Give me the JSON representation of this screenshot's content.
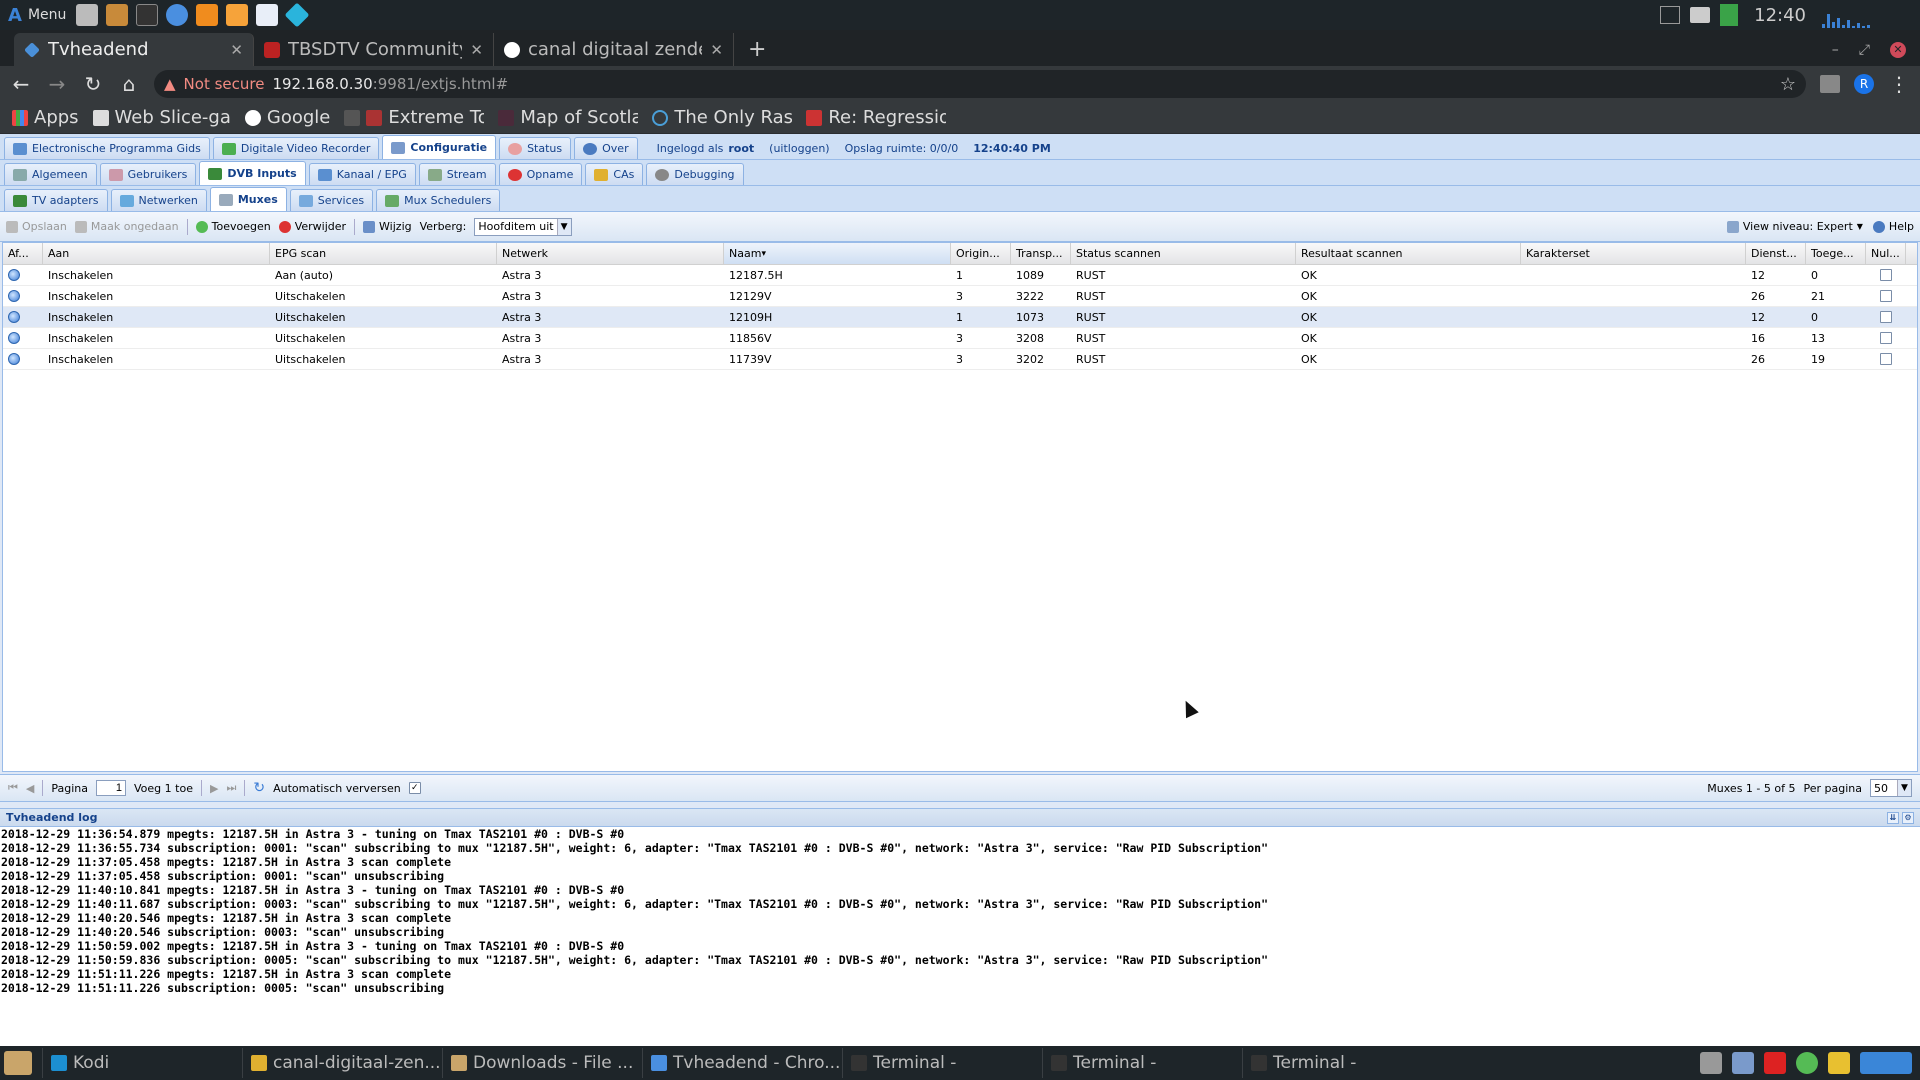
{
  "panel": {
    "menu_label": "Menu",
    "clock": "12:40"
  },
  "browser": {
    "tabs": [
      {
        "title": "Tvheadend",
        "active": true
      },
      {
        "title": "TBSDTV Community",
        "active": false
      },
      {
        "title": "canal digitaal zende",
        "active": false
      }
    ],
    "not_secure": "Not secure",
    "url_host": "192.168.0.30",
    "url_rest": ":9981/extjs.html#",
    "profile_initial": "R",
    "bookmarks": [
      "Apps",
      "Web Slice-ga",
      "Google",
      "Extreme Torr",
      "Map of Scotla",
      "The Only Ras",
      "Re: Regressio"
    ]
  },
  "tvh": {
    "main_tabs": [
      "Electronische Programma Gids",
      "Digitale Video Recorder",
      "Configuratie",
      "Status",
      "Over"
    ],
    "login_prefix": "Ingelogd als",
    "login_user": "root",
    "logout": "(uitloggen)",
    "storage": "Opslag ruimte: 0/0/0",
    "time": "12:40:40 PM",
    "config_tabs": [
      "Algemeen",
      "Gebruikers",
      "DVB Inputs",
      "Kanaal / EPG",
      "Stream",
      "Opname",
      "CAs",
      "Debugging"
    ],
    "dvb_tabs": [
      "TV adapters",
      "Netwerken",
      "Muxes",
      "Services",
      "Mux Schedulers"
    ],
    "toolbar": {
      "save": "Opslaan",
      "undo": "Maak ongedaan",
      "add": "Toevoegen",
      "delete": "Verwijder",
      "edit": "Wijzig",
      "hide_label": "Verberg:",
      "hide_value": "Hoofditem uit",
      "view_level": "View niveau: Expert",
      "help": "Help"
    },
    "columns": [
      "Af...",
      "Aan",
      "EPG scan",
      "Netwerk",
      "Naam",
      "Origin...",
      "Transp...",
      "Status scannen",
      "Resultaat scannen",
      "Karakterset",
      "Dienst...",
      "Toege...",
      "Nul..."
    ],
    "rows": [
      [
        "Inschakelen",
        "Aan (auto)",
        "Astra 3",
        "12187.5H",
        "1",
        "1089",
        "RUST",
        "OK",
        "",
        "12",
        "0"
      ],
      [
        "Inschakelen",
        "Uitschakelen",
        "Astra 3",
        "12129V",
        "3",
        "3222",
        "RUST",
        "OK",
        "",
        "26",
        "21"
      ],
      [
        "Inschakelen",
        "Uitschakelen",
        "Astra 3",
        "12109H",
        "1",
        "1073",
        "RUST",
        "OK",
        "",
        "12",
        "0"
      ],
      [
        "Inschakelen",
        "Uitschakelen",
        "Astra 3",
        "11856V",
        "3",
        "3208",
        "RUST",
        "OK",
        "",
        "16",
        "13"
      ],
      [
        "Inschakelen",
        "Uitschakelen",
        "Astra 3",
        "11739V",
        "3",
        "3202",
        "RUST",
        "OK",
        "",
        "26",
        "19"
      ]
    ],
    "pager": {
      "page_label": "Pagina",
      "page": "1",
      "of": "Voeg 1 toe",
      "auto_refresh": "Automatisch verversen",
      "summary": "Muxes 1 - 5 of 5",
      "per_page_label": "Per pagina",
      "per_page": "50"
    },
    "log_title": "Tvheadend log",
    "log_lines": [
      "2018-12-29 11:36:54.879 mpegts: 12187.5H in Astra 3 - tuning on Tmax TAS2101 #0 : DVB-S #0",
      "2018-12-29 11:36:55.734 subscription: 0001: \"scan\" subscribing to mux \"12187.5H\", weight: 6, adapter: \"Tmax TAS2101 #0 : DVB-S #0\", network: \"Astra 3\", service: \"Raw PID Subscription\"",
      "2018-12-29 11:37:05.458 mpegts: 12187.5H in Astra 3 scan complete",
      "2018-12-29 11:37:05.458 subscription: 0001: \"scan\" unsubscribing",
      "2018-12-29 11:40:10.841 mpegts: 12187.5H in Astra 3 - tuning on Tmax TAS2101 #0 : DVB-S #0",
      "2018-12-29 11:40:11.687 subscription: 0003: \"scan\" subscribing to mux \"12187.5H\", weight: 6, adapter: \"Tmax TAS2101 #0 : DVB-S #0\", network: \"Astra 3\", service: \"Raw PID Subscription\"",
      "2018-12-29 11:40:20.546 mpegts: 12187.5H in Astra 3 scan complete",
      "2018-12-29 11:40:20.546 subscription: 0003: \"scan\" unsubscribing",
      "2018-12-29 11:50:59.002 mpegts: 12187.5H in Astra 3 - tuning on Tmax TAS2101 #0 : DVB-S #0",
      "2018-12-29 11:50:59.836 subscription: 0005: \"scan\" subscribing to mux \"12187.5H\", weight: 6, adapter: \"Tmax TAS2101 #0 : DVB-S #0\", network: \"Astra 3\", service: \"Raw PID Subscription\"",
      "2018-12-29 11:51:11.226 mpegts: 12187.5H in Astra 3 scan complete",
      "2018-12-29 11:51:11.226 subscription: 0005: \"scan\" unsubscribing"
    ]
  },
  "taskbar": {
    "items": [
      "Kodi",
      "canal-digitaal-zen...",
      "Downloads - File ...",
      "Tvheadend - Chro...",
      "Terminal -",
      "Terminal -",
      "Terminal -"
    ]
  }
}
